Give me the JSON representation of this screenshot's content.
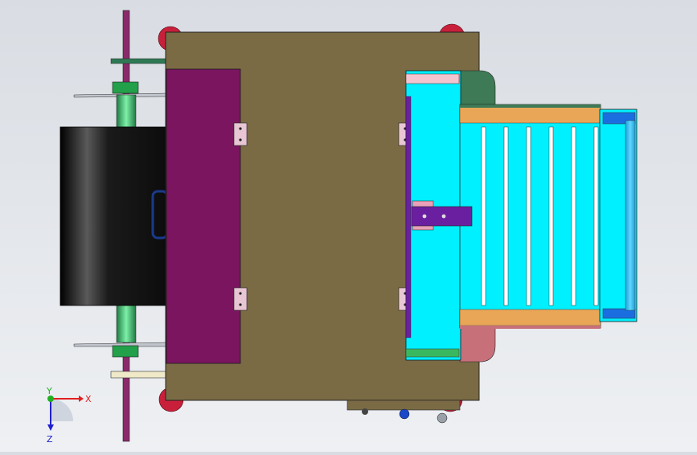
{
  "viewport": {
    "background_top": "#d9dde3",
    "background_bottom": "#eef0f3"
  },
  "triad": {
    "x_label": "X",
    "y_label": "Y",
    "z_label": "Z",
    "x_color": "#e02020",
    "y_color": "#20b020",
    "z_color": "#2020d0"
  },
  "colors": {
    "main_plate": "#7a6b45",
    "side_panel": "#7b1560",
    "roller_black": "#111111",
    "shaft": "#8a2a6a",
    "green_sleeve": "#30b060",
    "conveyor_cyan": "#00f0ff",
    "belt_blue": "#2aa8e0",
    "wheel_red": "#c8203a",
    "rail_orange": "#e9a657",
    "purple_bracket": "#6a1fa0"
  },
  "icons": {
    "axis": "coordinate-triad-icon",
    "hinge": "hinge-icon"
  }
}
